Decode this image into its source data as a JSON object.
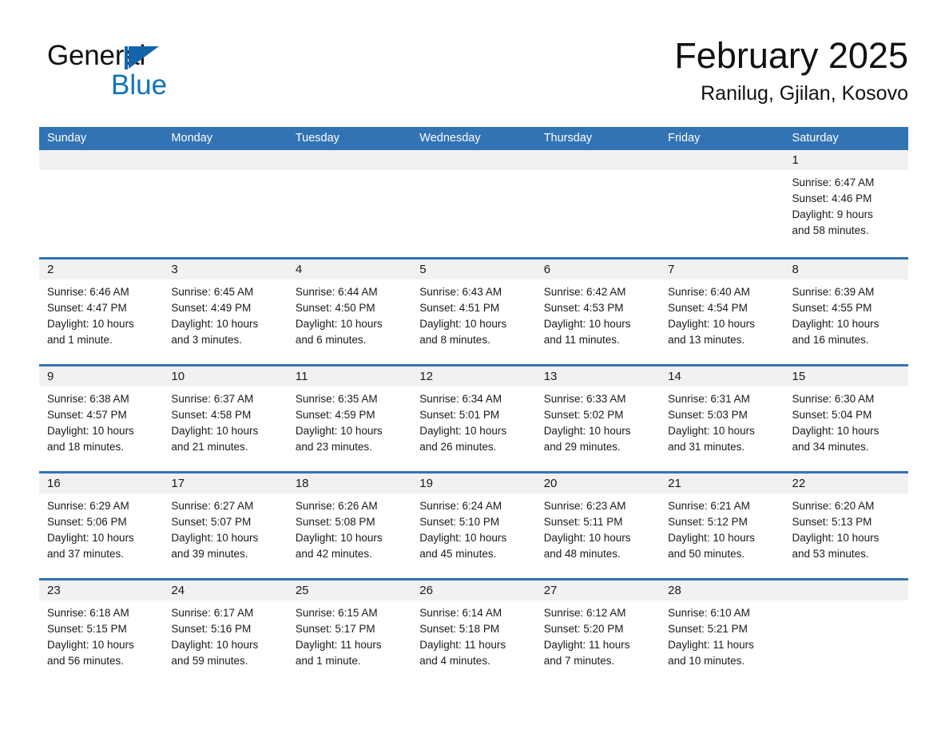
{
  "brand": {
    "line1": "General",
    "line2": "Blue",
    "triangle_color": "#1464aa",
    "blue_color": "#0f74bd"
  },
  "header": {
    "month_title": "February 2025",
    "location": "Ranilug, Gjilan, Kosovo",
    "accent_color": "#3273b4",
    "day_band_color": "#f1f1f1"
  },
  "weekdays": [
    "Sunday",
    "Monday",
    "Tuesday",
    "Wednesday",
    "Thursday",
    "Friday",
    "Saturday"
  ],
  "weeks": [
    [
      {
        "date": "",
        "sunrise": "",
        "sunset": "",
        "daylight": "",
        "daylight2": ""
      },
      {
        "date": "",
        "sunrise": "",
        "sunset": "",
        "daylight": "",
        "daylight2": ""
      },
      {
        "date": "",
        "sunrise": "",
        "sunset": "",
        "daylight": "",
        "daylight2": ""
      },
      {
        "date": "",
        "sunrise": "",
        "sunset": "",
        "daylight": "",
        "daylight2": ""
      },
      {
        "date": "",
        "sunrise": "",
        "sunset": "",
        "daylight": "",
        "daylight2": ""
      },
      {
        "date": "",
        "sunrise": "",
        "sunset": "",
        "daylight": "",
        "daylight2": ""
      },
      {
        "date": "1",
        "sunrise": "Sunrise: 6:47 AM",
        "sunset": "Sunset: 4:46 PM",
        "daylight": "Daylight: 9 hours",
        "daylight2": "and 58 minutes."
      }
    ],
    [
      {
        "date": "2",
        "sunrise": "Sunrise: 6:46 AM",
        "sunset": "Sunset: 4:47 PM",
        "daylight": "Daylight: 10 hours",
        "daylight2": "and 1 minute."
      },
      {
        "date": "3",
        "sunrise": "Sunrise: 6:45 AM",
        "sunset": "Sunset: 4:49 PM",
        "daylight": "Daylight: 10 hours",
        "daylight2": "and 3 minutes."
      },
      {
        "date": "4",
        "sunrise": "Sunrise: 6:44 AM",
        "sunset": "Sunset: 4:50 PM",
        "daylight": "Daylight: 10 hours",
        "daylight2": "and 6 minutes."
      },
      {
        "date": "5",
        "sunrise": "Sunrise: 6:43 AM",
        "sunset": "Sunset: 4:51 PM",
        "daylight": "Daylight: 10 hours",
        "daylight2": "and 8 minutes."
      },
      {
        "date": "6",
        "sunrise": "Sunrise: 6:42 AM",
        "sunset": "Sunset: 4:53 PM",
        "daylight": "Daylight: 10 hours",
        "daylight2": "and 11 minutes."
      },
      {
        "date": "7",
        "sunrise": "Sunrise: 6:40 AM",
        "sunset": "Sunset: 4:54 PM",
        "daylight": "Daylight: 10 hours",
        "daylight2": "and 13 minutes."
      },
      {
        "date": "8",
        "sunrise": "Sunrise: 6:39 AM",
        "sunset": "Sunset: 4:55 PM",
        "daylight": "Daylight: 10 hours",
        "daylight2": "and 16 minutes."
      }
    ],
    [
      {
        "date": "9",
        "sunrise": "Sunrise: 6:38 AM",
        "sunset": "Sunset: 4:57 PM",
        "daylight": "Daylight: 10 hours",
        "daylight2": "and 18 minutes."
      },
      {
        "date": "10",
        "sunrise": "Sunrise: 6:37 AM",
        "sunset": "Sunset: 4:58 PM",
        "daylight": "Daylight: 10 hours",
        "daylight2": "and 21 minutes."
      },
      {
        "date": "11",
        "sunrise": "Sunrise: 6:35 AM",
        "sunset": "Sunset: 4:59 PM",
        "daylight": "Daylight: 10 hours",
        "daylight2": "and 23 minutes."
      },
      {
        "date": "12",
        "sunrise": "Sunrise: 6:34 AM",
        "sunset": "Sunset: 5:01 PM",
        "daylight": "Daylight: 10 hours",
        "daylight2": "and 26 minutes."
      },
      {
        "date": "13",
        "sunrise": "Sunrise: 6:33 AM",
        "sunset": "Sunset: 5:02 PM",
        "daylight": "Daylight: 10 hours",
        "daylight2": "and 29 minutes."
      },
      {
        "date": "14",
        "sunrise": "Sunrise: 6:31 AM",
        "sunset": "Sunset: 5:03 PM",
        "daylight": "Daylight: 10 hours",
        "daylight2": "and 31 minutes."
      },
      {
        "date": "15",
        "sunrise": "Sunrise: 6:30 AM",
        "sunset": "Sunset: 5:04 PM",
        "daylight": "Daylight: 10 hours",
        "daylight2": "and 34 minutes."
      }
    ],
    [
      {
        "date": "16",
        "sunrise": "Sunrise: 6:29 AM",
        "sunset": "Sunset: 5:06 PM",
        "daylight": "Daylight: 10 hours",
        "daylight2": "and 37 minutes."
      },
      {
        "date": "17",
        "sunrise": "Sunrise: 6:27 AM",
        "sunset": "Sunset: 5:07 PM",
        "daylight": "Daylight: 10 hours",
        "daylight2": "and 39 minutes."
      },
      {
        "date": "18",
        "sunrise": "Sunrise: 6:26 AM",
        "sunset": "Sunset: 5:08 PM",
        "daylight": "Daylight: 10 hours",
        "daylight2": "and 42 minutes."
      },
      {
        "date": "19",
        "sunrise": "Sunrise: 6:24 AM",
        "sunset": "Sunset: 5:10 PM",
        "daylight": "Daylight: 10 hours",
        "daylight2": "and 45 minutes."
      },
      {
        "date": "20",
        "sunrise": "Sunrise: 6:23 AM",
        "sunset": "Sunset: 5:11 PM",
        "daylight": "Daylight: 10 hours",
        "daylight2": "and 48 minutes."
      },
      {
        "date": "21",
        "sunrise": "Sunrise: 6:21 AM",
        "sunset": "Sunset: 5:12 PM",
        "daylight": "Daylight: 10 hours",
        "daylight2": "and 50 minutes."
      },
      {
        "date": "22",
        "sunrise": "Sunrise: 6:20 AM",
        "sunset": "Sunset: 5:13 PM",
        "daylight": "Daylight: 10 hours",
        "daylight2": "and 53 minutes."
      }
    ],
    [
      {
        "date": "23",
        "sunrise": "Sunrise: 6:18 AM",
        "sunset": "Sunset: 5:15 PM",
        "daylight": "Daylight: 10 hours",
        "daylight2": "and 56 minutes."
      },
      {
        "date": "24",
        "sunrise": "Sunrise: 6:17 AM",
        "sunset": "Sunset: 5:16 PM",
        "daylight": "Daylight: 10 hours",
        "daylight2": "and 59 minutes."
      },
      {
        "date": "25",
        "sunrise": "Sunrise: 6:15 AM",
        "sunset": "Sunset: 5:17 PM",
        "daylight": "Daylight: 11 hours",
        "daylight2": "and 1 minute."
      },
      {
        "date": "26",
        "sunrise": "Sunrise: 6:14 AM",
        "sunset": "Sunset: 5:18 PM",
        "daylight": "Daylight: 11 hours",
        "daylight2": "and 4 minutes."
      },
      {
        "date": "27",
        "sunrise": "Sunrise: 6:12 AM",
        "sunset": "Sunset: 5:20 PM",
        "daylight": "Daylight: 11 hours",
        "daylight2": "and 7 minutes."
      },
      {
        "date": "28",
        "sunrise": "Sunrise: 6:10 AM",
        "sunset": "Sunset: 5:21 PM",
        "daylight": "Daylight: 11 hours",
        "daylight2": "and 10 minutes."
      },
      {
        "date": "",
        "sunrise": "",
        "sunset": "",
        "daylight": "",
        "daylight2": ""
      }
    ]
  ]
}
